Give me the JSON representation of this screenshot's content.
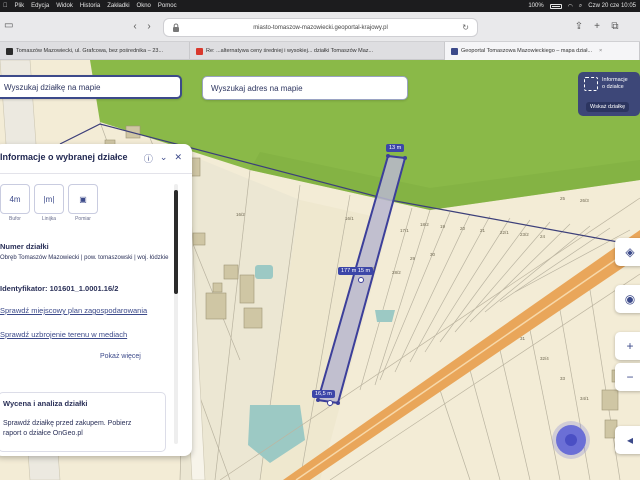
{
  "menubar": {
    "apple": "",
    "items": [
      "Plik",
      "Edycja",
      "Widok",
      "Historia",
      "Zakładki",
      "Okno",
      "Pomoc"
    ],
    "battery": "100%",
    "datetime": "Czw 20 cze 10:05"
  },
  "browser": {
    "url": "miasto-tomaszow-mazowiecki.geoportal-krajowy.pl",
    "tabs": [
      {
        "label": "Tomaszów Mazowiecki, ul. Grafcowa, bez pośrednika – 23...",
        "favicon_color": "#2b2b2b"
      },
      {
        "label": "Re: ...alternatywa ceny średniej i wysokiej... działki Tomaszów Maz...",
        "favicon_color": "#d9382c"
      },
      {
        "label": "Geoportal Tomaszowa Mazowieckiego – mapa dział...",
        "favicon_color": "#3c4a8a"
      }
    ]
  },
  "search": {
    "parcel_label": "Wyszukaj działkę na mapie",
    "address_label": "Wyszukaj adres na mapie"
  },
  "info_box": {
    "line1": "Informacje",
    "line2": "o działce",
    "button": "Wskaż działkę"
  },
  "panel": {
    "title": "Informacje o wybranej działce",
    "tools": [
      {
        "icon": "4m",
        "label": "Bufor"
      },
      {
        "icon": "|m|",
        "label": "Linijka"
      },
      {
        "icon": "▣",
        "label": "Pomiar"
      }
    ],
    "number_label": "Numer działki",
    "location": "Obręb Tomaszów Mazowiecki | pow. tomaszowski | woj. łódzkie",
    "id_label": "Identyfikator: 101601_1.0001.16/2",
    "link_plan": "Sprawdź miejscowy plan zagospodarowania",
    "link_utility": "Sprawdź uzbrojenie terenu w mediach",
    "more": "Pokaż więcej",
    "card_title": "Wycena i analiza działki",
    "card_body_1": "Sprawdź działkę przed zakupem. Pobierz",
    "card_body_2": "raport o działce OnGeo.pl"
  },
  "dimensions": {
    "top": "13 m",
    "mid": "177 m  15 m",
    "bottom": "16,5 m"
  },
  "parcel_numbers": [
    "16/2",
    "16/1",
    "17/1",
    "18/2",
    "19",
    "20",
    "21",
    "22/1",
    "23/2",
    "24",
    "25",
    "26/3",
    "27",
    "28/2",
    "29",
    "30",
    "31",
    "32/4",
    "33",
    "34/1"
  ],
  "colors": {
    "field_green": "#8ab948",
    "map_bg": "#f3ecd6",
    "road_orange": "#e9a65a",
    "parcel_fill": "#b9b7cf",
    "accent": "#3c4a8a",
    "water": "#9cc9c4"
  }
}
